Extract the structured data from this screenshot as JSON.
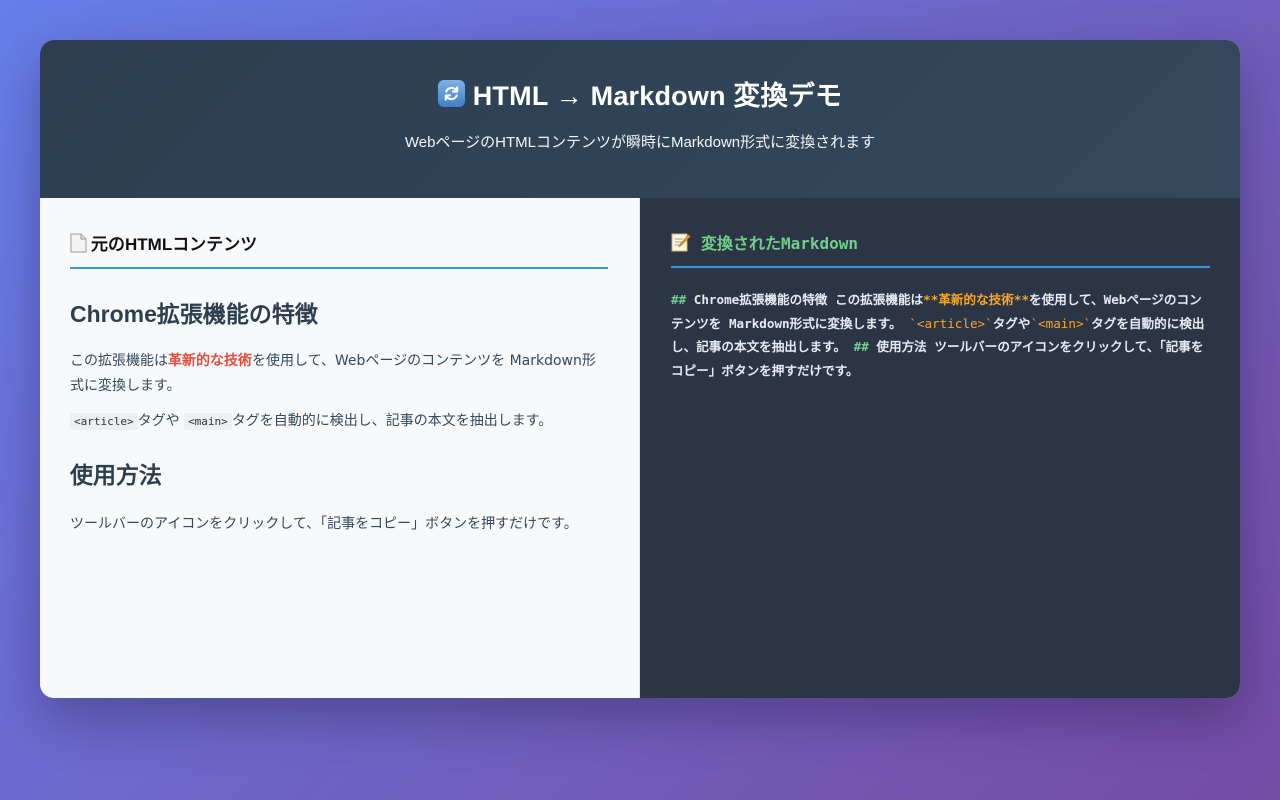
{
  "header": {
    "title": "HTML → Markdown 変換デモ",
    "subtitle": "WebページのHTMLコンテンツが瞬時にMarkdown形式に変換されます",
    "icon": "refresh-icon"
  },
  "left_panel": {
    "title": "元のHTMLコンテンツ",
    "icon": "document-icon",
    "heading1": "Chrome拡張機能の特徴",
    "p1_before": "この拡張機能は",
    "p1_strong": "革新的な技術",
    "p1_after": "を使用して、Webページのコンテンツを Markdown形式に変換します。",
    "p2_code1": "<article>",
    "p2_mid": "タグや",
    "p2_code2": "<main>",
    "p2_after": "タグを自動的に検出し、記事の本文を抽出します。",
    "heading2": "使用方法",
    "p3": "ツールバーのアイコンをクリックして、「記事をコピー」ボタンを押すだけです。"
  },
  "right_panel": {
    "title": "変換されたMarkdown",
    "icon": "memo-icon",
    "md_h1_mark": "##",
    "md_h1_text": " Chrome拡張機能の特徴 この拡張機能は",
    "md_bold": "**革新的な技術**",
    "md_after_bold": "を使用して、Webページのコンテンツを Markdown形式に変換します。 ",
    "md_code1": "`<article>`",
    "md_mid": "タグや",
    "md_code2": "`<main>`",
    "md_after_code": "タグを自動的に検出し、記事の本文を抽出します。 ",
    "md_h2_mark": "##",
    "md_h2_text": " 使用方法 ツールバーのアイコンをクリックして、「記事をコピー」ボタンを押すだけです。"
  },
  "colors": {
    "bg_from": "#667eea",
    "bg_to": "#764ba2",
    "header_bg": "#2c3e50",
    "accent_blue": "#3498db",
    "strong_red": "#e74c3c",
    "md_green": "#6fcf8a",
    "md_orange": "#f5a623",
    "dark_panel": "#2c3546"
  }
}
